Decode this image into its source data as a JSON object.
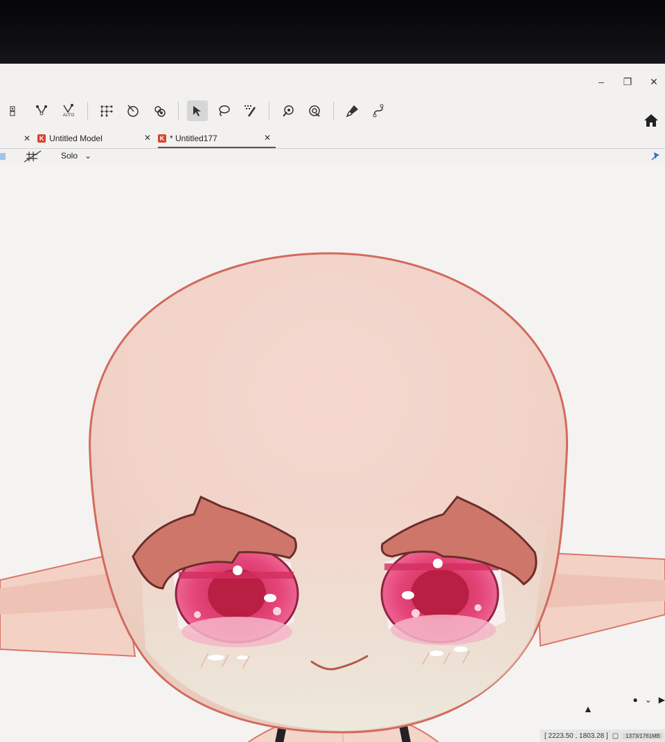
{
  "window": {
    "controls": [
      "–",
      "❐",
      "✕"
    ]
  },
  "toolbar": {
    "tools": [
      {
        "icon": "layout-icon"
      },
      {
        "icon": "warp-deformer-icon"
      },
      {
        "icon": "auto-mesh-icon",
        "label": "AUTO"
      },
      {
        "icon": "mesh-edit-icon"
      },
      {
        "icon": "rotation-deformer-icon"
      },
      {
        "icon": "glue-icon"
      },
      {
        "icon": "select-arrow-icon",
        "active": true
      },
      {
        "icon": "lasso-icon"
      },
      {
        "icon": "brush-select-icon"
      },
      {
        "icon": "deform-brush-icon"
      },
      {
        "icon": "deform-path-icon"
      },
      {
        "icon": "pen-icon"
      },
      {
        "icon": "path-icon"
      }
    ]
  },
  "tabs": [
    {
      "label": "Untitled Model",
      "active": false
    },
    {
      "label": "* Untitled177",
      "active": true
    }
  ],
  "viewbar": {
    "mode_label": "Solo",
    "mode_arrow": "⌄"
  },
  "status": {
    "coordinates": "[ 2223.50 , 1803.28 ]",
    "memory": "1373/1761MB"
  },
  "colors": {
    "skin": "#f3cfc4",
    "outline": "#d9756a",
    "brow": "#cf766b",
    "iris": "#e8467a",
    "choker": "#1f1f24"
  }
}
